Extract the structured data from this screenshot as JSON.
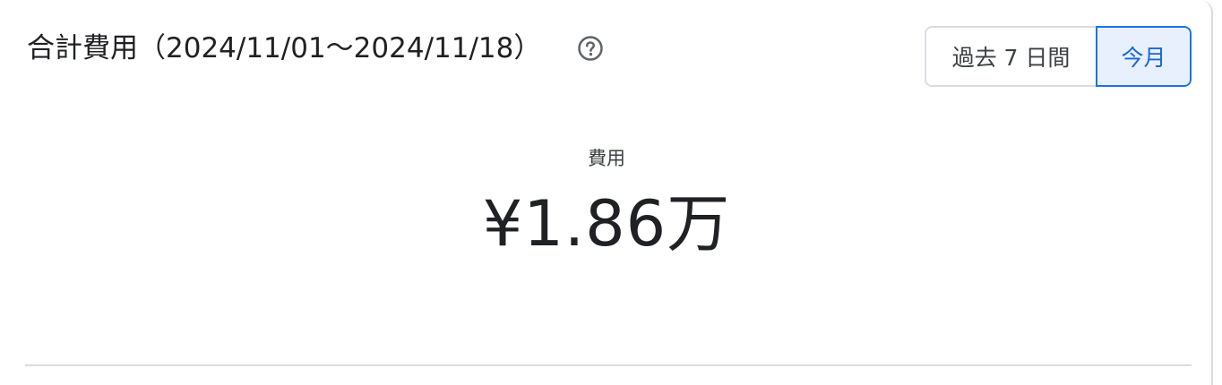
{
  "header": {
    "title": "合計費用（2024/11/01〜2024/11/18）",
    "help_icon": "help-circle-icon"
  },
  "period_toggle": {
    "options": [
      {
        "label": "過去 7 日間",
        "selected": false
      },
      {
        "label": "今月",
        "selected": true
      }
    ]
  },
  "metric": {
    "label": "費用",
    "value": "¥1.86万"
  },
  "colors": {
    "accent": "#1a73e8",
    "selected_bg": "#e8f0fe",
    "border": "#dadce0",
    "text": "#202124"
  }
}
